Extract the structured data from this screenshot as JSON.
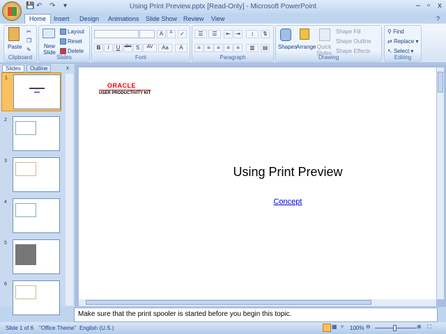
{
  "window": {
    "title": "Using Print Preview.pptx [Read-Only] - Microsoft PowerPoint",
    "minimize": "–",
    "maximize": "▫",
    "close": "x"
  },
  "qat": {
    "save": "💾",
    "undo": "↶",
    "redo": "↷",
    "customize": "▾"
  },
  "tabs": [
    "Home",
    "Insert",
    "Design",
    "Animations",
    "Slide Show",
    "Review",
    "View"
  ],
  "ribbon": {
    "clipboard": {
      "label": "Clipboard",
      "paste": "Paste"
    },
    "slides": {
      "label": "Slides",
      "new_slide": "New Slide",
      "layout": "Layout",
      "reset": "Reset",
      "delete": "Delete"
    },
    "font": {
      "label": "Font",
      "bold": "B",
      "italic": "I",
      "underline": "U",
      "strike": "abe",
      "shadow": "S",
      "spacing": "AV",
      "case": "Aa",
      "color": "A",
      "grow": "A",
      "shrink": "A"
    },
    "paragraph": {
      "label": "Paragraph"
    },
    "drawing": {
      "label": "Drawing",
      "shapes": "Shapes",
      "arrange": "Arrange",
      "quick_styles": "Quick Styles",
      "shape_fill": "Shape Fill",
      "shape_outline": "Shape Outline",
      "shape_effects": "Shape Effects"
    },
    "editing": {
      "label": "Editing",
      "find": "Find",
      "replace": "Replace",
      "select": "Select"
    }
  },
  "panel": {
    "tabs": [
      "Slides",
      "Outline"
    ],
    "thumbnails": [
      "1",
      "2",
      "3",
      "4",
      "5",
      "6"
    ]
  },
  "slide": {
    "logo": "ORACLE",
    "logo_sub": "USER PRODUCTIVITY KIT",
    "title": "Using Print Preview",
    "link": "Concept"
  },
  "notes": "Make sure that the print spooler is started before you begin this topic.",
  "status": {
    "slide": "Slide 1 of 6",
    "theme": "\"Office Theme\"",
    "language": "English (U.S.)",
    "zoom": "100%"
  }
}
